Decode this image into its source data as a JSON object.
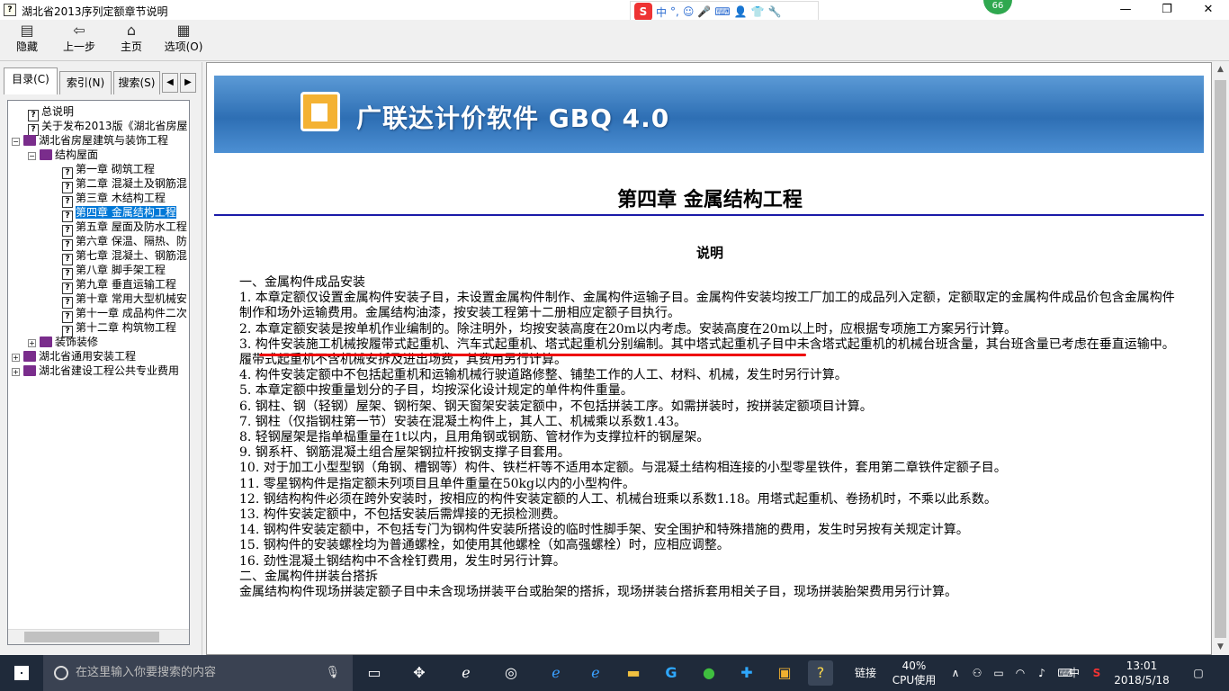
{
  "window": {
    "title": "湖北省2013序列定额章节说明",
    "controls": [
      "—",
      "❐",
      "✕"
    ]
  },
  "ime_bar": {
    "logo": "S",
    "mode": "中",
    "punct": "°,",
    "items": [
      "☺",
      "🎤",
      "⌨",
      "👤",
      "👕",
      "🔧"
    ]
  },
  "badge": "66",
  "toolbar": {
    "hide": "隐藏",
    "back": "上一步",
    "home": "主页",
    "options": "选项(O)"
  },
  "tabs": {
    "contents": "目录(C)",
    "index": "索引(N)",
    "search": "搜索(S)"
  },
  "tree": [
    {
      "label": "总说明",
      "type": "page"
    },
    {
      "label": "关于发布2013版《湖北省房屋",
      "type": "page"
    },
    {
      "label": "湖北省房屋建筑与装饰工程",
      "type": "book-open",
      "expander": "−"
    },
    {
      "label": "结构屋面",
      "type": "book-open",
      "expander": "−"
    },
    {
      "label": "第一章  砌筑工程",
      "type": "page"
    },
    {
      "label": "第二章  混凝土及钢筋混",
      "type": "page"
    },
    {
      "label": "第三章  木结构工程",
      "type": "page"
    },
    {
      "label": "第四章  金属结构工程",
      "type": "page",
      "selected": true
    },
    {
      "label": "第五章  屋面及防水工程",
      "type": "page"
    },
    {
      "label": "第六章  保温、隔热、防",
      "type": "page"
    },
    {
      "label": "第七章  混凝土、钢筋混",
      "type": "page"
    },
    {
      "label": "第八章  脚手架工程",
      "type": "page"
    },
    {
      "label": "第九章  垂直运输工程",
      "type": "page"
    },
    {
      "label": "第十章  常用大型机械安",
      "type": "page"
    },
    {
      "label": "第十一章  成品构件二次",
      "type": "page"
    },
    {
      "label": "第十二章  构筑物工程",
      "type": "page"
    },
    {
      "label": "装饰装修",
      "type": "book",
      "expander": "+"
    },
    {
      "label": "湖北省通用安装工程",
      "type": "book",
      "expander": "+"
    },
    {
      "label": "湖北省建设工程公共专业费用",
      "type": "book",
      "expander": "+"
    }
  ],
  "banner": {
    "title": "广联达计价软件 GBQ 4.0"
  },
  "doc": {
    "chapter": "第四章  金属结构工程",
    "heading": "说明",
    "paragraphs": [
      "一、金属构件成品安装",
      "1. 本章定额仅设置金属构件安装子目，未设置金属构件制作、金属构件运输子目。金属构件安装均按工厂加工的成品列入定额，定额取定的金属构件成品价包含金属构件制作和场外运输费用。金属结构油漆，按安装工程第十二册相应定额子目执行。",
      "2. 本章定额安装是按单机作业编制的。除注明外，均按安装高度在20m以内考虑。安装高度在20m以上时，应根据专项施工方案另行计算。",
      "3. 构件安装施工机械按履带式起重机、汽车式起重机、塔式起重机分别编制。其中塔式起重机子目中未含塔式起重机的机械台班含量，其台班含量已考虑在垂直运输中。履带式起重机不含机械安拆及进出场费，其费用另行计算。",
      "4. 构件安装定额中不包括起重机和运输机械行驶道路修整、铺垫工作的人工、材料、机械，发生时另行计算。",
      "5. 本章定额中按重量划分的子目，均按深化设计规定的单件构件重量。",
      "6. 钢柱、钢（轻钢）屋架、钢桁架、钢天窗架安装定额中，不包括拼装工序。如需拼装时，按拼装定额项目计算。",
      "7. 钢柱（仅指钢柱第一节）安装在混凝土构件上，其人工、机械乘以系数1.43。",
      "8. 轻钢屋架是指单榀重量在1t以内，且用角钢或钢筋、管材作为支撑拉杆的钢屋架。",
      "9. 钢系杆、钢筋混凝土组合屋架钢拉杆按钢支撑子目套用。",
      "10. 对于加工小型型钢（角钢、槽钢等）构件、铁栏杆等不适用本定额。与混凝土结构相连接的小型零星铁件，套用第二章铁件定额子目。",
      "11. 零星钢构件是指定额未列项目且单件重量在50kg以内的小型构件。",
      "12. 钢结构构件必须在跨外安装时，按相应的构件安装定额的人工、机械台班乘以系数1.18。用塔式起重机、卷扬机时，不乘以此系数。",
      "13. 构件安装定额中，不包括安装后需焊接的无损检测费。",
      "14. 钢构件安装定额中，不包括专门为钢构件安装所搭设的临时性脚手架、安全围护和特殊措施的费用，发生时另按有关规定计算。",
      "15. 钢构件的安装螺栓均为普通螺栓，如使用其他螺栓（如高强螺栓）时，应相应调整。",
      "16. 劲性混凝土钢结构中不含栓钉费用，发生时另行计算。",
      "二、金属构件拼装台搭拆",
      "金属结构构件现场拼装定额子目中未含现场拼装平台或胎架的搭拆，现场拼装台搭拆套用相关子目，现场拼装胎架费用另行计算。"
    ]
  },
  "taskbar": {
    "search_placeholder": "在这里输入你要搜索的内容",
    "link": "链接",
    "cpu_pct": "40%",
    "cpu_label": "CPU使用",
    "lang": "中",
    "time": "13:01",
    "date": "2018/5/18"
  },
  "colors": {
    "selection": "#0078d7",
    "rule": "#1a1aa8",
    "annotation": "#e00000",
    "taskbar": "#1f2a3a"
  }
}
